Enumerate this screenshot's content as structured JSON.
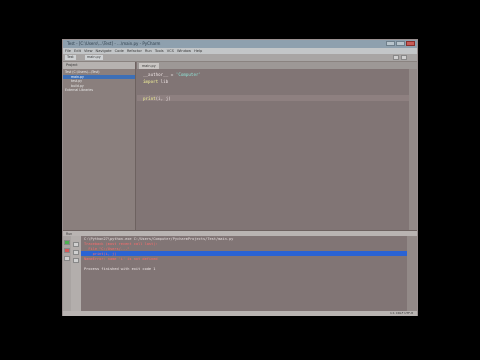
{
  "window": {
    "title": "Test - [C:\\Users\\...\\Test] - ...\\main.py - PyCharm"
  },
  "menu": [
    "File",
    "Edit",
    "View",
    "Navigate",
    "Code",
    "Refactor",
    "Run",
    "Tools",
    "VCS",
    "Window",
    "Help"
  ],
  "toolbar": {
    "crumb1": "Test",
    "crumb2": "main.py"
  },
  "sidebar": {
    "header": "Project",
    "items": [
      "Test (C:\\Users\\...\\Test)",
      "main.py",
      "test.py",
      "build.py",
      "External Libraries"
    ]
  },
  "editor": {
    "tab": "main.py",
    "lines": [
      {
        "a": "__author__",
        "b": " = ",
        "c": "'Computer'"
      },
      {
        "a": "import",
        "b": " lib",
        "c": ""
      },
      {
        "a": "print",
        "b": "(i, j)",
        "c": ""
      }
    ]
  },
  "run": {
    "header": "Run",
    "lines": [
      "C:\\Python27\\python.exe C:/Users/Computer/PycharmProjects/Test/main.py",
      "Traceback (most recent call last):",
      "  File \"C:/Users/...\"",
      "    print(i, j)",
      "NameError: name 'i' is not defined",
      "",
      "Process finished with exit code 1"
    ]
  },
  "status": {
    "text": "1:1  CRLF  UTF-8"
  }
}
